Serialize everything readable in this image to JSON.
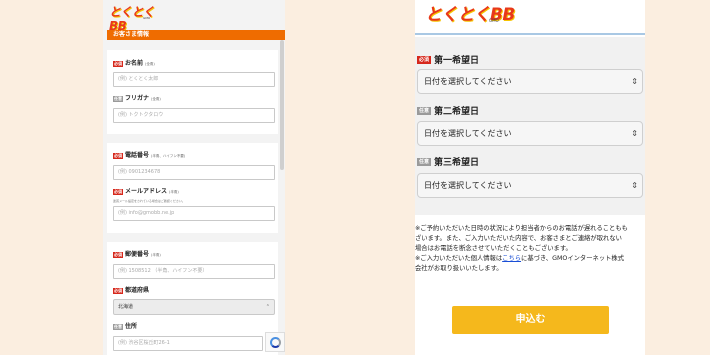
{
  "left": {
    "logo": {
      "text": "とくとくBB",
      "sub": "GMO"
    },
    "section_title": "お客さま情報",
    "fields": {
      "name": {
        "badge": "必須",
        "label": "お名前",
        "note": "(全角)",
        "placeholder": "(例) とくとく太郎"
      },
      "kana": {
        "badge": "任意",
        "label": "フリガナ",
        "note": "(全角)",
        "placeholder": "(例) トクトクタロウ"
      },
      "phone": {
        "badge": "必須",
        "label": "電話番号",
        "note": "(半角、ハイフン不要)",
        "placeholder": "(例) 0901234678"
      },
      "email": {
        "badge": "必須",
        "label": "メールアドレス",
        "note": "(半角)",
        "small_note": "迷惑メール設定をされている場合はご確認ください。",
        "placeholder": "(例) info@gmobb.ne.jp"
      },
      "postal": {
        "badge": "必須",
        "label": "郵便番号",
        "note": "(半角)",
        "placeholder": "(例) 1508512 （半角、ハイフン不要）"
      },
      "prefecture": {
        "badge": "必須",
        "label": "都道府県",
        "value": "北海道"
      },
      "address": {
        "badge": "任意",
        "label": "住所",
        "placeholder": "(例) 渋谷区桜丘町26-1"
      }
    }
  },
  "right": {
    "logo": {
      "text": "とくとくBB",
      "sub": "GMO"
    },
    "choices": [
      {
        "badge": "必須",
        "label": "第一希望日",
        "placeholder": "日付を選択してください"
      },
      {
        "badge": "任意",
        "label": "第二希望日",
        "placeholder": "日付を選択してください"
      },
      {
        "badge": "任意",
        "label": "第三希望日",
        "placeholder": "日付を選択してください"
      }
    ],
    "notes": {
      "line1": "※ご予約いただいた日時の状況により担当者からのお電話が遅れることもも",
      "line2": "ざいます。また、ご入力いただいた内容で、お客さまとご連絡が取れない",
      "line3": "場合はお電話を断念させていただくこともございます。",
      "line4_pre": "※ご入力いただいた個人情報は",
      "line4_link": "こちら",
      "line4_post": "に基づき、GMOインターネット株式",
      "line5": "会社がお取り扱いいたします。"
    },
    "submit_label": "申込む"
  },
  "colors": {
    "accent_orange": "#ef6c00",
    "required_red": "#d6281c",
    "submit_yellow": "#f5b81c",
    "link_blue": "#1a4fd6"
  }
}
